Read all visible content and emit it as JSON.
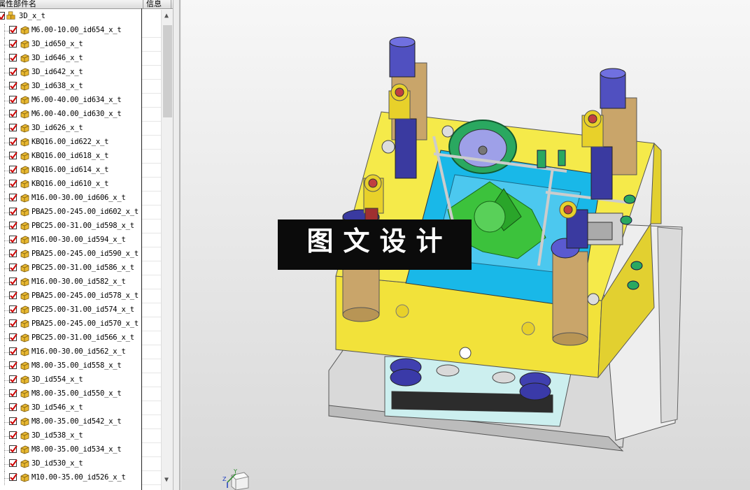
{
  "tree_panel": {
    "header": {
      "name_col": "属性部件名",
      "info_col": "信息"
    },
    "root": {
      "label": "3D_x_t"
    },
    "items": [
      {
        "label": "M6.00-10.00_id654_x_t"
      },
      {
        "label": "3D_id650_x_t"
      },
      {
        "label": "3D_id646_x_t"
      },
      {
        "label": "3D_id642_x_t"
      },
      {
        "label": "3D_id638_x_t"
      },
      {
        "label": "M6.00-40.00_id634_x_t"
      },
      {
        "label": "M6.00-40.00_id630_x_t"
      },
      {
        "label": "3D_id626_x_t"
      },
      {
        "label": "KBQ16.00_id622_x_t"
      },
      {
        "label": "KBQ16.00_id618_x_t"
      },
      {
        "label": "KBQ16.00_id614_x_t"
      },
      {
        "label": "KBQ16.00_id610_x_t"
      },
      {
        "label": "M16.00-30.00_id606_x_t"
      },
      {
        "label": "PBA25.00-245.00_id602_x_t"
      },
      {
        "label": "PBC25.00-31.00_id598_x_t"
      },
      {
        "label": "M16.00-30.00_id594_x_t"
      },
      {
        "label": "PBA25.00-245.00_id590_x_t"
      },
      {
        "label": "PBC25.00-31.00_id586_x_t"
      },
      {
        "label": "M16.00-30.00_id582_x_t"
      },
      {
        "label": "PBA25.00-245.00_id578_x_t"
      },
      {
        "label": "PBC25.00-31.00_id574_x_t"
      },
      {
        "label": "PBA25.00-245.00_id570_x_t"
      },
      {
        "label": "PBC25.00-31.00_id566_x_t"
      },
      {
        "label": "M16.00-30.00_id562_x_t"
      },
      {
        "label": "M8.00-35.00_id558_x_t"
      },
      {
        "label": "3D_id554_x_t"
      },
      {
        "label": "M8.00-35.00_id550_x_t"
      },
      {
        "label": "3D_id546_x_t"
      },
      {
        "label": "M8.00-35.00_id542_x_t"
      },
      {
        "label": "3D_id538_x_t"
      },
      {
        "label": "M8.00-35.00_id534_x_t"
      },
      {
        "label": "3D_id530_x_t"
      },
      {
        "label": "M10.00-35.00_id526_x_t"
      }
    ]
  },
  "viewport": {
    "banner_text": "图文设计",
    "triad": {
      "y_label": "Y",
      "z_label": "Z"
    }
  },
  "colors": {
    "plate_yellow": "#f2e23a",
    "cavity_cyan": "#19b8e8",
    "core_green": "#3cc23c",
    "pillar_tan": "#c9a56a",
    "pillar_blue": "#3a3aa0",
    "check_red": "#cc0000",
    "part_cube": "#e8b830"
  }
}
